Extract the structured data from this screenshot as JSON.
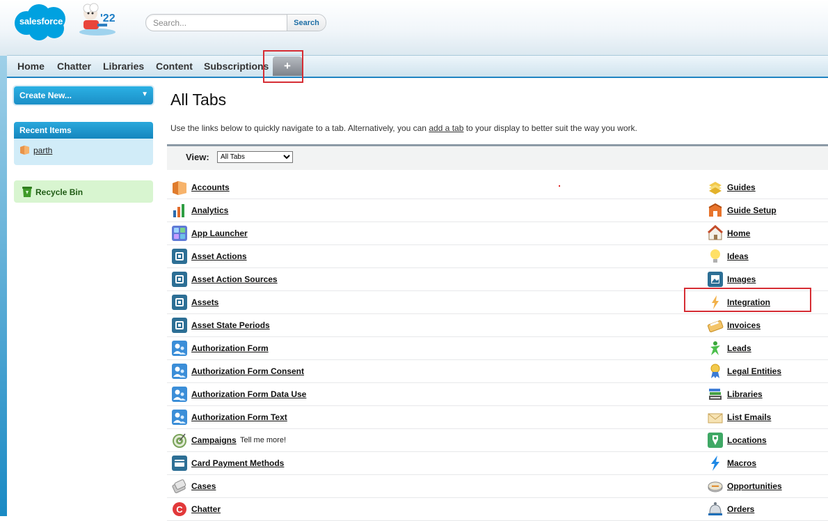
{
  "header": {
    "logo_text": "salesforce",
    "release_label": "'22",
    "search": {
      "placeholder": "Search...",
      "button_label": "Search"
    }
  },
  "tabs": [
    {
      "label": "Home"
    },
    {
      "label": "Chatter"
    },
    {
      "label": "Libraries"
    },
    {
      "label": "Content"
    },
    {
      "label": "Subscriptions"
    }
  ],
  "add_tab_symbol": "+",
  "sidebar": {
    "create_new_label": "Create New...",
    "recent_items_title": "Recent Items",
    "recent_items": [
      {
        "label": "parth"
      }
    ],
    "recycle_bin_label": "Recycle Bin"
  },
  "main": {
    "title": "All Tabs",
    "intro_before": "Use the links below to quickly navigate to a tab. Alternatively, you can ",
    "intro_link": "add a tab",
    "intro_after": " to your display to better suit the way you work.",
    "view_label": "View:",
    "view_selected": "All Tabs"
  },
  "tab_list": {
    "left": [
      {
        "label": "Accounts",
        "icon": "folder-icon"
      },
      {
        "label": "Analytics",
        "icon": "bar-chart-icon"
      },
      {
        "label": "App Launcher",
        "icon": "app-grid-icon"
      },
      {
        "label": "Asset Actions",
        "icon": "asset-icon"
      },
      {
        "label": "Asset Action Sources",
        "icon": "asset-icon"
      },
      {
        "label": "Assets",
        "icon": "asset-icon"
      },
      {
        "label": "Asset State Periods",
        "icon": "asset-icon"
      },
      {
        "label": "Authorization Form",
        "icon": "users-icon"
      },
      {
        "label": "Authorization Form Consent",
        "icon": "users-icon"
      },
      {
        "label": "Authorization Form Data Use",
        "icon": "users-icon"
      },
      {
        "label": "Authorization Form Text",
        "icon": "users-icon"
      },
      {
        "label": "Campaigns",
        "icon": "target-icon",
        "extra": "Tell me more!"
      },
      {
        "label": "Card Payment Methods",
        "icon": "card-icon"
      },
      {
        "label": "Cases",
        "icon": "cases-icon"
      },
      {
        "label": "Chatter",
        "icon": "chatter-icon"
      }
    ],
    "right": [
      {
        "label": "Guides",
        "icon": "guides-icon"
      },
      {
        "label": "Guide Setup",
        "icon": "guide-setup-icon"
      },
      {
        "label": "Home",
        "icon": "house-icon"
      },
      {
        "label": "Ideas",
        "icon": "lightbulb-icon"
      },
      {
        "label": "Images",
        "icon": "images-icon"
      },
      {
        "label": "Integration",
        "icon": "lightning-bolt-icon"
      },
      {
        "label": "Invoices",
        "icon": "calculator-icon"
      },
      {
        "label": "Leads",
        "icon": "person-icon"
      },
      {
        "label": "Legal Entities",
        "icon": "ribbon-icon"
      },
      {
        "label": "Libraries",
        "icon": "library-icon"
      },
      {
        "label": "List Emails",
        "icon": "envelope-icon"
      },
      {
        "label": "Locations",
        "icon": "location-icon"
      },
      {
        "label": "Macros",
        "icon": "bolt-icon"
      },
      {
        "label": "Opportunities",
        "icon": "coins-icon"
      },
      {
        "label": "Orders",
        "icon": "bell-icon"
      }
    ]
  },
  "colors": {
    "brand_blue": "#00a1e0",
    "tab_accent": "#1f84c2",
    "highlight_red": "#d62d34",
    "recycle_green": "#d8f5d0"
  }
}
